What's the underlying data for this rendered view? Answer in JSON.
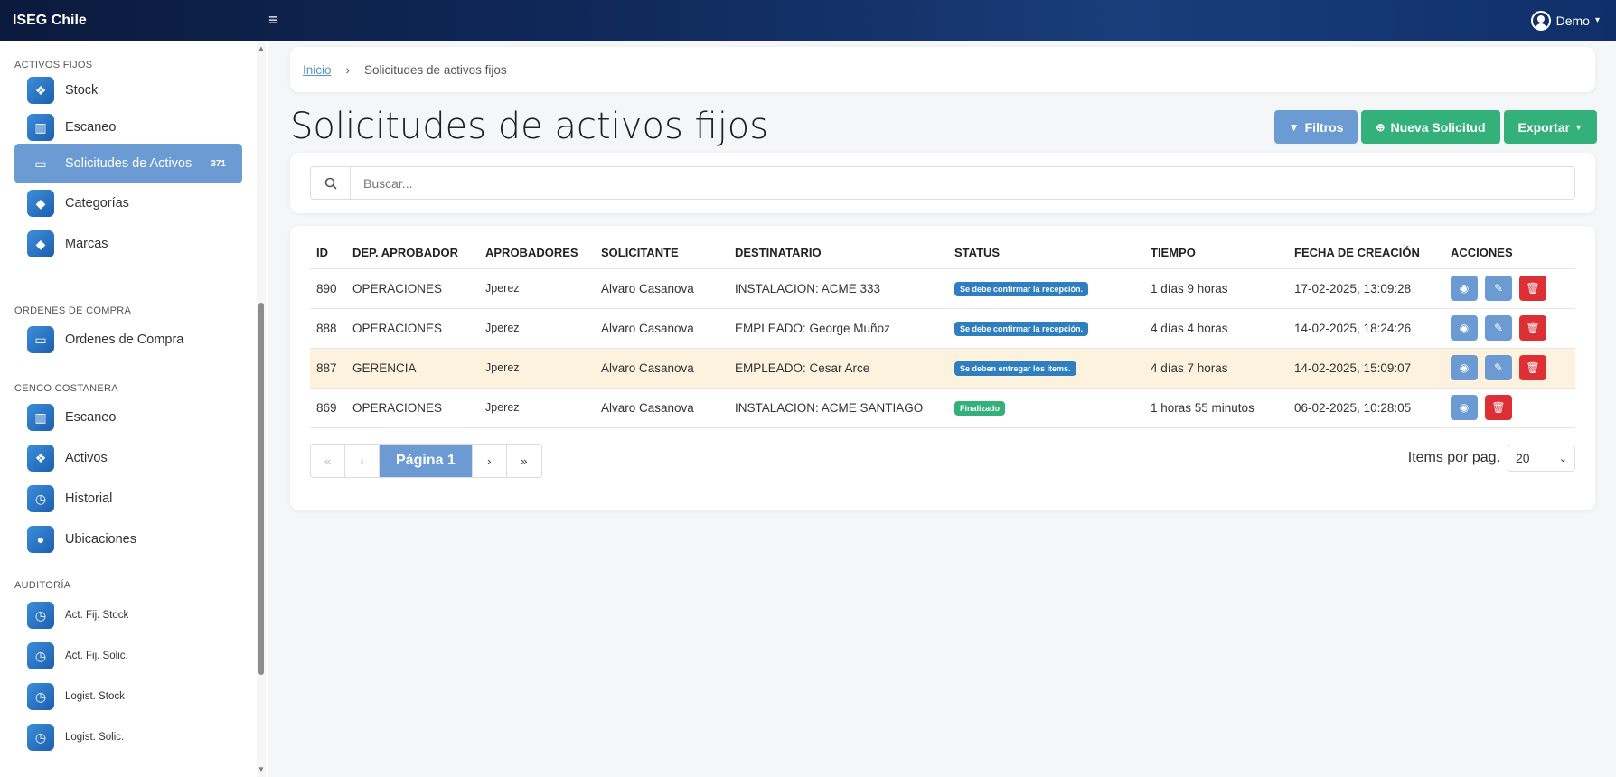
{
  "app": {
    "brand": "ISEG Chile",
    "menu_icon": "≡",
    "user": "Demo"
  },
  "sidebar": {
    "sections": [
      {
        "title": "ACTIVOS FIJOS"
      },
      {
        "title": "ORDENES DE COMPRA"
      },
      {
        "title": "CENCO COSTANERA"
      },
      {
        "title": "AUDITORÍA"
      }
    ],
    "items": [
      {
        "label": "Stock",
        "icon": "cubes-icon"
      },
      {
        "label": "Escaneo",
        "icon": "barcode-icon"
      },
      {
        "label": "Solicitudes de Activos",
        "icon": "ticket-icon",
        "count": "371"
      },
      {
        "label": "Categorías",
        "icon": "tag-icon"
      },
      {
        "label": "Marcas",
        "icon": "tag-icon"
      },
      {
        "label": "Ordenes de Compra",
        "icon": "ticket-icon"
      },
      {
        "label": "Escaneo",
        "icon": "barcode-icon"
      },
      {
        "label": "Activos",
        "icon": "cubes-icon"
      },
      {
        "label": "Historial",
        "icon": "clock-icon"
      },
      {
        "label": "Ubicaciones",
        "icon": "map-pin-icon"
      },
      {
        "label": "Act. Fij. Stock",
        "icon": "clock-icon"
      },
      {
        "label": "Act. Fij. Solic.",
        "icon": "clock-icon"
      },
      {
        "label": "Logist. Stock",
        "icon": "clock-icon"
      },
      {
        "label": "Logist. Solic.",
        "icon": "clock-icon"
      }
    ]
  },
  "breadcrumb": {
    "home": "Inicio",
    "separator": "›",
    "current": "Solicitudes de activos fijos"
  },
  "page": {
    "title": "Solicitudes de activos fijos",
    "buttons": {
      "filters": "Filtros",
      "new": "Nueva Solicitud",
      "export": "Exportar"
    }
  },
  "search": {
    "placeholder": "Buscar..."
  },
  "table": {
    "headers": [
      "ID",
      "DEP. APROBADOR",
      "APROBADORES",
      "SOLICITANTE",
      "DESTINATARIO",
      "STATUS",
      "TIEMPO",
      "FECHA DE CREACIÓN",
      "ACCIONES"
    ],
    "rows": [
      [
        "890",
        "OPERACIONES",
        "Jperez",
        "Alvaro Casanova",
        "INSTALACION: ACME 333",
        "Se debe confirmar la recepción.",
        "1 días 9 horas",
        "17-02-2025, 13:09:28"
      ],
      [
        "888",
        "OPERACIONES",
        "Jperez",
        "Alvaro Casanova",
        "EMPLEADO: George Muñoz",
        "Se debe confirmar la recepción.",
        "4 días 4 horas",
        "14-02-2025, 18:24:26"
      ],
      [
        "887",
        "GERENCIA",
        "Jperez",
        "Alvaro Casanova",
        "EMPLEADO: Cesar Arce",
        "Se deben entregar los ítems.",
        "4 días 7 horas",
        "14-02-2025, 15:09:07"
      ],
      [
        "869",
        "OPERACIONES",
        "Jperez",
        "Alvaro Casanova",
        "INSTALACION: ACME SANTIAGO",
        "Finalizado",
        "1 horas 55 minutos",
        "06-02-2025, 10:28:05"
      ]
    ]
  },
  "pagination": {
    "first": "«",
    "prev": "‹",
    "current": "Página 1",
    "next": "›",
    "last": "»"
  },
  "per_page": {
    "label": "Items por pag.",
    "value": "20"
  },
  "colors": {
    "accent": "#6b9bd2",
    "success": "#34b07a",
    "danger": "#dc3035",
    "info": "#2f7fc0",
    "highlight_row": "#fdf2dd"
  }
}
